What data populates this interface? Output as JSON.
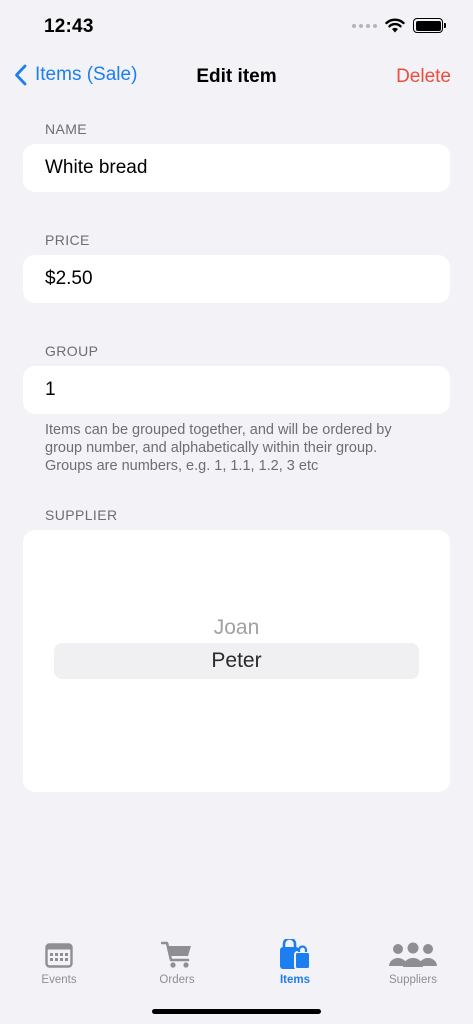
{
  "status_bar": {
    "time": "12:43"
  },
  "nav": {
    "back_label": "Items (Sale)",
    "title": "Edit item",
    "delete_label": "Delete"
  },
  "form": {
    "name": {
      "header": "NAME",
      "value": "White bread"
    },
    "price": {
      "header": "PRICE",
      "value": "$2.50"
    },
    "group": {
      "header": "GROUP",
      "value": "1",
      "footer_lines": [
        "Items can be grouped together, and will be ordered by",
        "group number, and alphabetically within their group.",
        "Groups are numbers, e.g. 1, 1.1, 1.2, 3 etc"
      ]
    },
    "supplier": {
      "header": "SUPPLIER",
      "options": [
        "Joan",
        "Peter"
      ],
      "selected": "Peter"
    }
  },
  "tabs": [
    {
      "label": "Events",
      "icon": "calendar-icon",
      "active": false
    },
    {
      "label": "Orders",
      "icon": "cart-icon",
      "active": false
    },
    {
      "label": "Items",
      "icon": "shopping-bags-icon",
      "active": true
    },
    {
      "label": "Suppliers",
      "icon": "people-icon",
      "active": false
    }
  ],
  "colors": {
    "accent": "#1c7ef0",
    "destructive": "#eb4e3d",
    "background": "#f2f2f7",
    "inactive_tab": "#8e8e93"
  }
}
